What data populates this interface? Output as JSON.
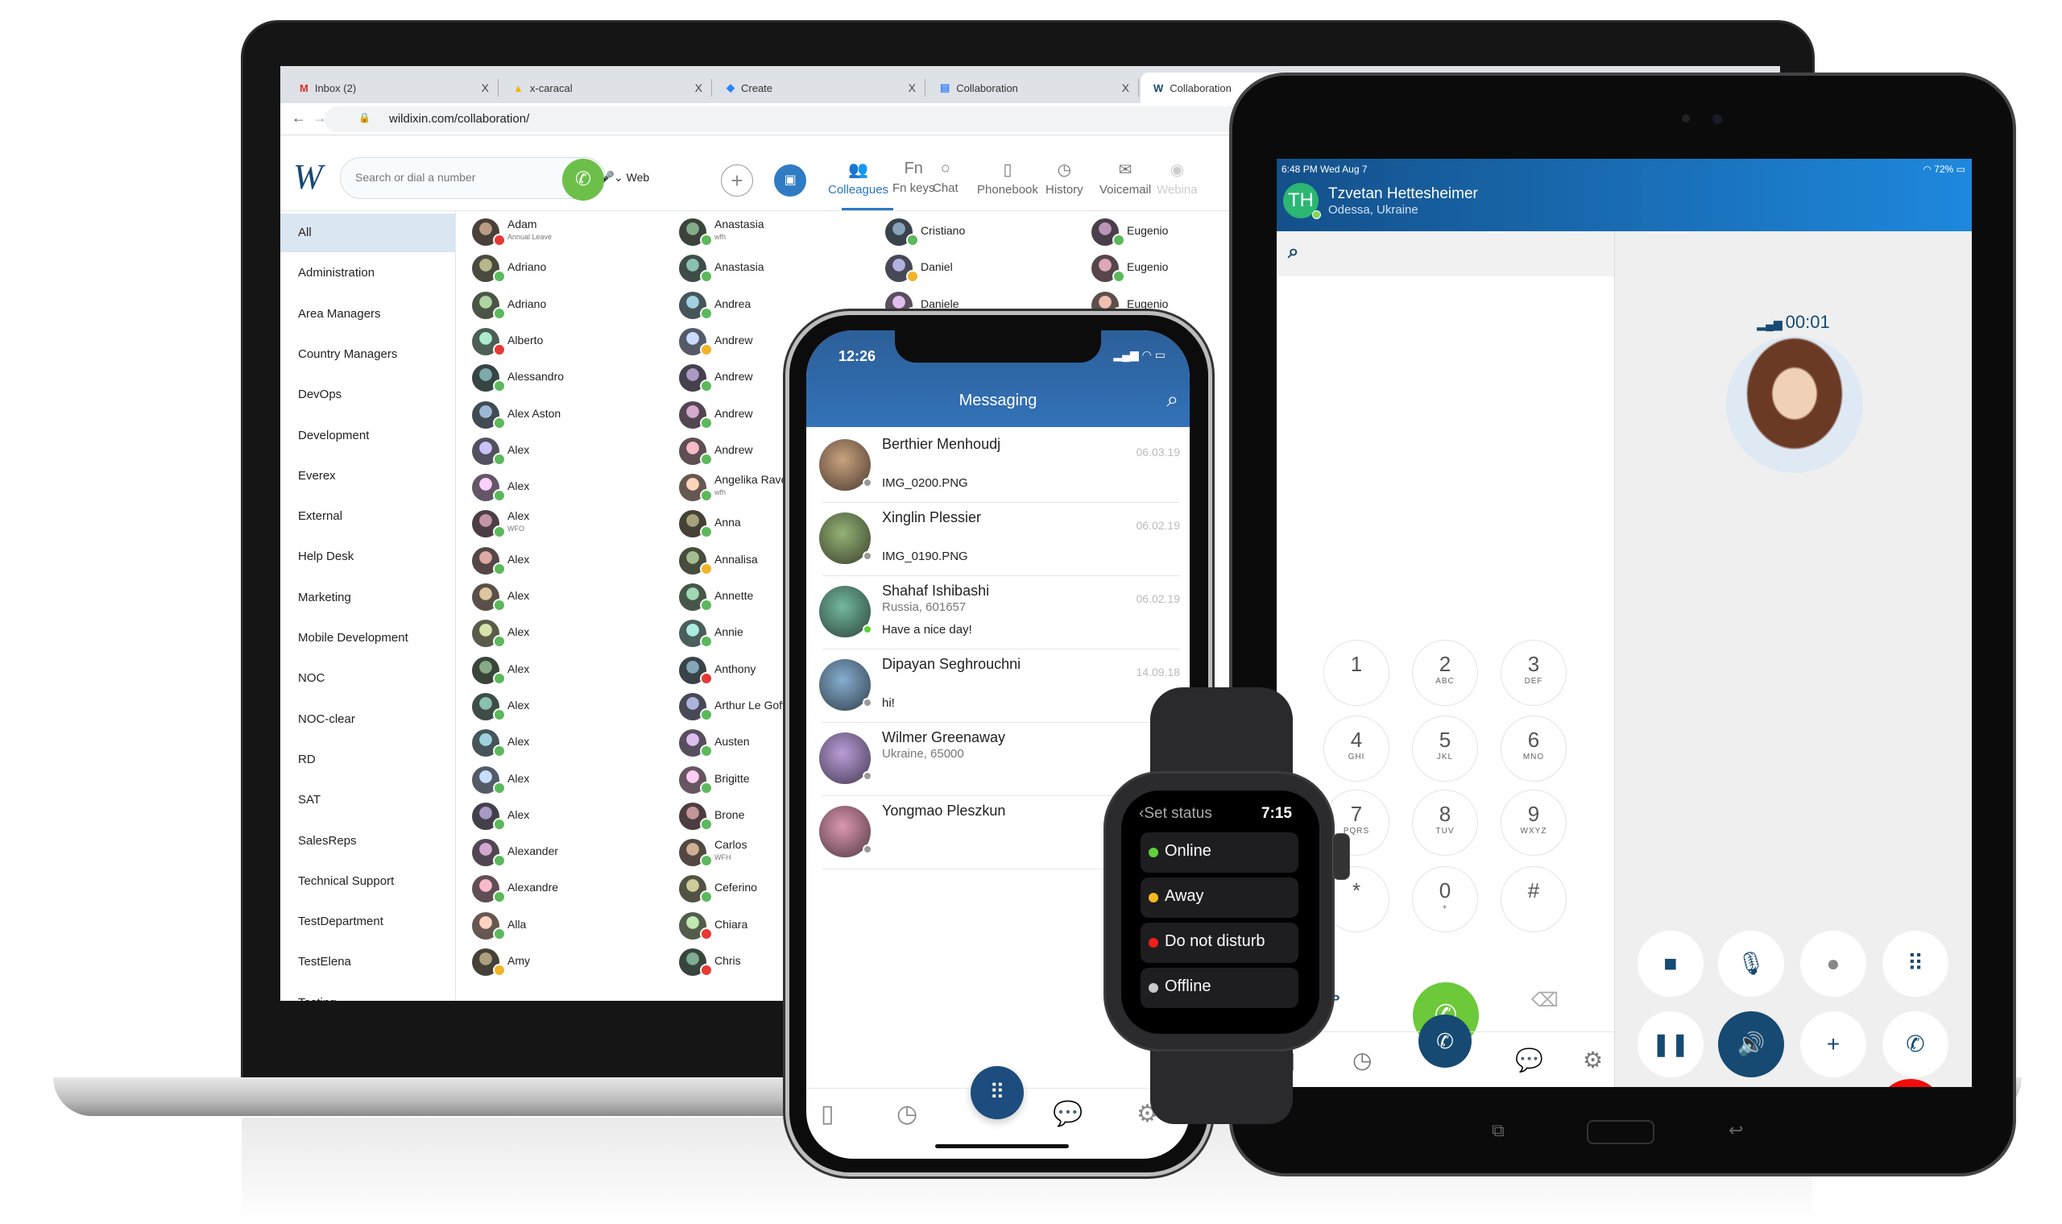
{
  "browser": {
    "tabs": [
      {
        "label": "Inbox (2)",
        "icon": "gmail-icon"
      },
      {
        "label": "x-caracal",
        "icon": "drive-icon"
      },
      {
        "label": "Create",
        "icon": "jira-icon"
      },
      {
        "label": "Collaboration",
        "icon": "docs-icon"
      },
      {
        "label": "Collaboration",
        "icon": "wildix-icon"
      }
    ],
    "close": "X",
    "url": "wildixin.com/collaboration/"
  },
  "app": {
    "logo": "W",
    "search_placeholder": "Search or dial a number",
    "device": "Web",
    "nav": [
      {
        "label": "Colleagues",
        "icon": "colleagues-icon"
      },
      {
        "label": "Fn keys",
        "icon": "fn-keys-icon"
      },
      {
        "label": "Chat",
        "icon": "chat-icon"
      },
      {
        "label": "Phonebook",
        "icon": "phonebook-icon"
      },
      {
        "label": "History",
        "icon": "history-icon"
      },
      {
        "label": "Voicemail",
        "icon": "voicemail-icon"
      },
      {
        "label": "Webina",
        "icon": "webinar-icon"
      }
    ],
    "active_tab": "Colleagues"
  },
  "sidebar": {
    "items": [
      "All",
      "Administration",
      "Area Managers",
      "Country Managers",
      "DevOps",
      "Development",
      "Everex",
      "External",
      "Help Desk",
      "Marketing",
      "Mobile Development",
      "NOC",
      "NOC-clear",
      "RD",
      "SAT",
      "SalesReps",
      "Technical Support",
      "TestDepartment",
      "TestElena",
      "Testing"
    ],
    "active": "All"
  },
  "status_colors": {
    "online": "#5cb85c",
    "away": "#f0b429",
    "dnd": "#e53935",
    "busy": "#e53935",
    "offline": "#9e9e9e"
  },
  "colleagues": [
    [
      {
        "n": "Adam",
        "s": "dnd",
        "sub": "Annual Leave"
      },
      {
        "n": "Adriano",
        "s": "online"
      },
      {
        "n": "Adriano",
        "s": "online"
      },
      {
        "n": "Alberto",
        "s": "dnd"
      },
      {
        "n": "Alessandro",
        "s": "online"
      },
      {
        "n": "Alex Aston",
        "s": "online"
      },
      {
        "n": "Alex",
        "s": "online"
      },
      {
        "n": "Alex",
        "s": "online"
      },
      {
        "n": "Alex",
        "s": "online",
        "sub": "WFO"
      },
      {
        "n": "Alex",
        "s": "online"
      },
      {
        "n": "Alex",
        "s": "online"
      },
      {
        "n": "Alex",
        "s": "online"
      },
      {
        "n": "Alex",
        "s": "online"
      },
      {
        "n": "Alex",
        "s": "online"
      },
      {
        "n": "Alex",
        "s": "online"
      },
      {
        "n": "Alex",
        "s": "online"
      },
      {
        "n": "Alex",
        "s": "online"
      },
      {
        "n": "Alexander",
        "s": "online"
      },
      {
        "n": "Alexandre",
        "s": "online"
      },
      {
        "n": "Alla",
        "s": "online"
      },
      {
        "n": "Amy",
        "s": "away"
      }
    ],
    [
      {
        "n": "Anastasia",
        "s": "online",
        "sub": "wfh"
      },
      {
        "n": "Anastasia",
        "s": "online"
      },
      {
        "n": "Andrea",
        "s": "online"
      },
      {
        "n": "Andrew",
        "s": "away"
      },
      {
        "n": "Andrew",
        "s": "online"
      },
      {
        "n": "Andrew",
        "s": "online"
      },
      {
        "n": "Andrew",
        "s": "online"
      },
      {
        "n": "Angelika Rave",
        "s": "online",
        "sub": "wfh"
      },
      {
        "n": "Anna",
        "s": "online"
      },
      {
        "n": "Annalisa",
        "s": "away"
      },
      {
        "n": "Annette",
        "s": "online"
      },
      {
        "n": "Annie",
        "s": "online"
      },
      {
        "n": "Anthony",
        "s": "busy"
      },
      {
        "n": "Arthur Le Goff",
        "s": "online"
      },
      {
        "n": "Austen",
        "s": "online"
      },
      {
        "n": "Brigitte",
        "s": "online"
      },
      {
        "n": "Brone",
        "s": "online"
      },
      {
        "n": "Carlos",
        "s": "online",
        "sub": "WFH"
      },
      {
        "n": "Ceferino",
        "s": "online"
      },
      {
        "n": "Chiara",
        "s": "dnd"
      },
      {
        "n": "Chris",
        "s": "dnd"
      }
    ],
    [
      {
        "n": "Cristiano",
        "s": "online"
      },
      {
        "n": "Daniel",
        "s": "away"
      },
      {
        "n": "Daniele",
        "s": "online"
      }
    ],
    [
      {
        "n": "Eugenio",
        "s": "online"
      },
      {
        "n": "Eugenio",
        "s": "online"
      },
      {
        "n": "Eugenio",
        "s": "online"
      }
    ]
  ],
  "phone": {
    "time": "12:26",
    "title": "Messaging",
    "messages": [
      {
        "name": "Berthier Menhoudj",
        "preview": "IMG_0200.PNG",
        "date": "06.03.19",
        "s": "offline"
      },
      {
        "name": "Xinglin Plessier",
        "preview": "IMG_0190.PNG",
        "date": "06.02.19",
        "s": "offline"
      },
      {
        "name": "Shahaf Ishibashi",
        "location": "Russia, 601657",
        "preview": "Have a nice day!",
        "date": "06.02.19",
        "s": "online"
      },
      {
        "name": "Dipayan Seghrouchni",
        "preview": "hi!",
        "date": "14.09.18",
        "s": "offline"
      },
      {
        "name": "Wilmer Greenaway",
        "location": "Ukraine, 65000",
        "s": "offline"
      },
      {
        "name": "Yongmao Pleszkun",
        "s": "offline"
      }
    ]
  },
  "watch": {
    "title": "Set status",
    "time": "7:15",
    "options": [
      {
        "label": "Online",
        "color": "#5fd13a"
      },
      {
        "label": "Away",
        "color": "#f5b820"
      },
      {
        "label": "Do not disturb",
        "color": "#f0201c"
      },
      {
        "label": "Offline",
        "color": "#c8c8c8"
      }
    ]
  },
  "tablet": {
    "status_time": "6:48 PM  Wed Aug 7",
    "battery": "72%",
    "initials": "TH",
    "name": "Tzvetan Hettesheimer",
    "location": "Odessa, Ukraine",
    "timer": "00:01",
    "line": "VoIP",
    "keys": [
      {
        "d": "1",
        "l": ""
      },
      {
        "d": "2",
        "l": "ABC"
      },
      {
        "d": "3",
        "l": "DEF"
      },
      {
        "d": "4",
        "l": "GHI"
      },
      {
        "d": "5",
        "l": "JKL"
      },
      {
        "d": "6",
        "l": "MNO"
      },
      {
        "d": "7",
        "l": "PQRS"
      },
      {
        "d": "8",
        "l": "TUV"
      },
      {
        "d": "9",
        "l": "WXYZ"
      },
      {
        "d": "*",
        "l": ""
      },
      {
        "d": "0",
        "l": "+"
      },
      {
        "d": "#",
        "l": ""
      }
    ],
    "controls": [
      {
        "name": "video-button",
        "glyph": "■",
        "on": false
      },
      {
        "name": "mute-button",
        "glyph": "🎙",
        "on": false
      },
      {
        "name": "record-button",
        "glyph": "●",
        "on": false
      },
      {
        "name": "keypad-button",
        "glyph": "⠿",
        "on": false
      },
      {
        "name": "hold-button",
        "glyph": "❚❚",
        "on": false
      },
      {
        "name": "speaker-button",
        "glyph": "🔊",
        "on": true
      },
      {
        "name": "add-call-button",
        "glyph": "+",
        "on": false
      },
      {
        "name": "transfer-button",
        "glyph": "✆",
        "on": false
      }
    ]
  },
  "colors": {
    "accent": "#2a78c2",
    "navy": "#164a72",
    "call_green": "#6cc04a",
    "hangup_red": "#f20c0c"
  }
}
